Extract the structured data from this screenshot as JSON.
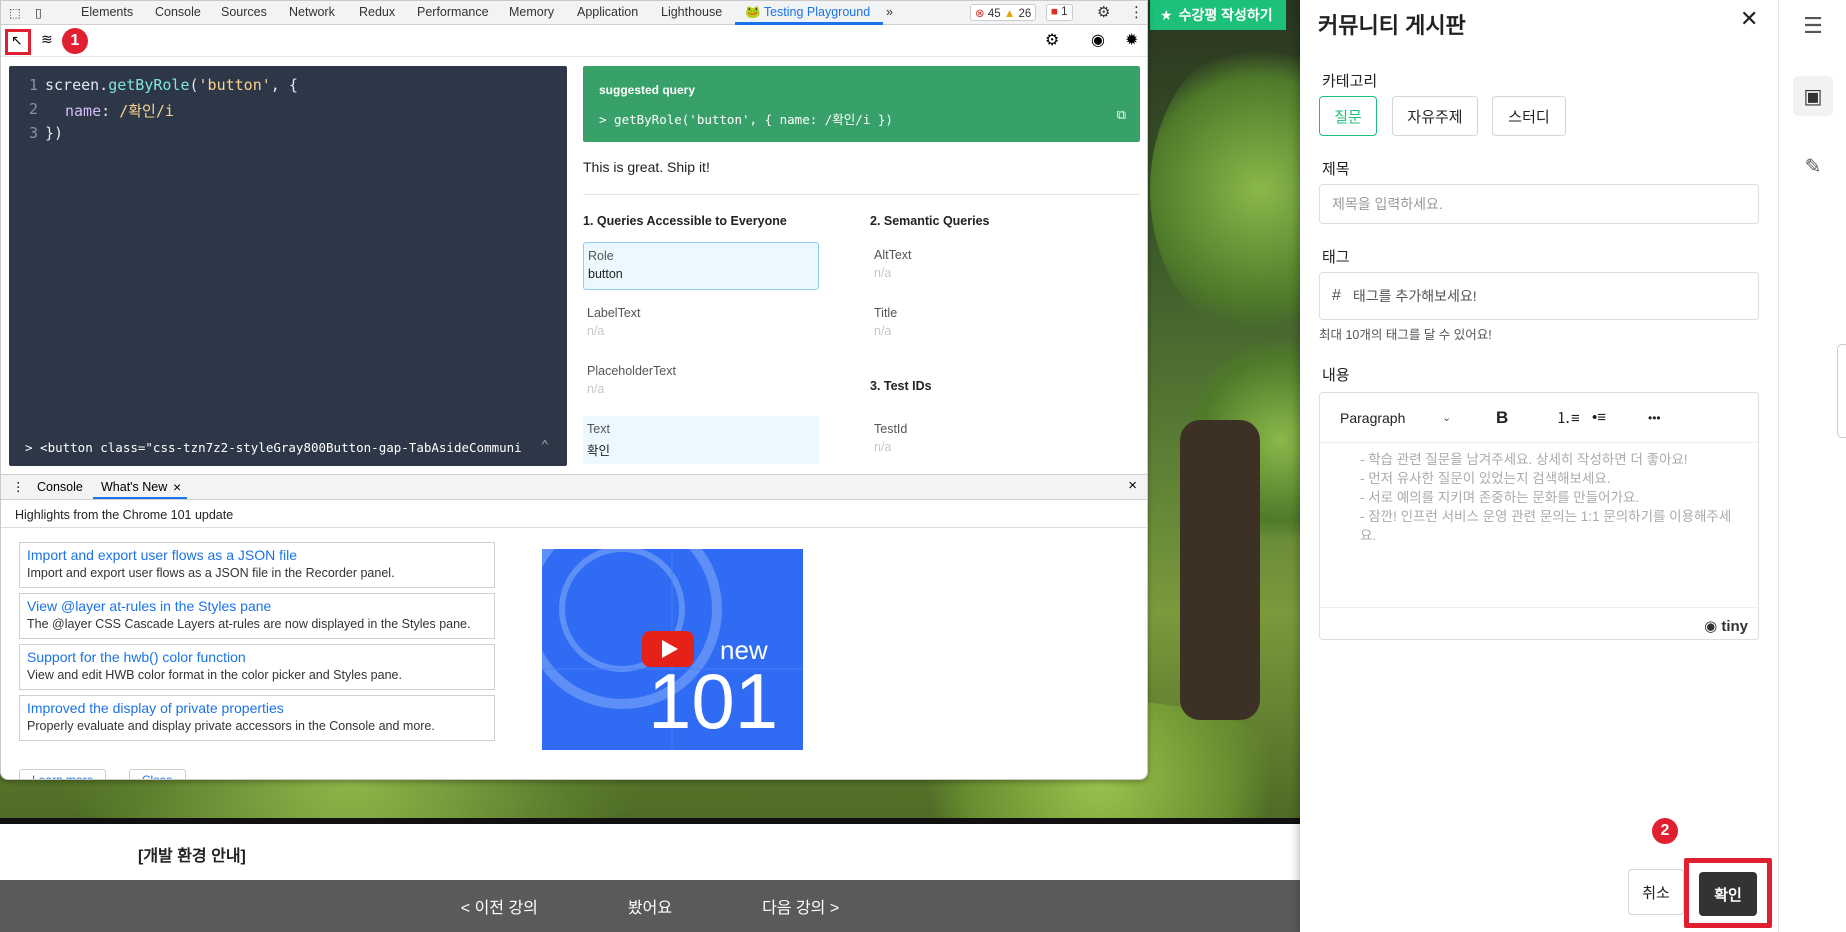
{
  "devtools": {
    "tabs": [
      "Elements",
      "Console",
      "Sources",
      "Network",
      "Redux",
      "Performance",
      "Memory",
      "Application",
      "Lighthouse",
      "Testing Playground"
    ],
    "active_tab": "Testing Playground",
    "more": "»",
    "errors": "45",
    "warnings": "26",
    "issues": "1",
    "marker1": "1",
    "editor": {
      "line_numbers": [
        "1",
        "2",
        "3"
      ],
      "line1_a": "screen.",
      "line1_b": "getByRole",
      "line1_c": "(",
      "line1_d": "'button'",
      "line1_e": ", {",
      "line2_a": "name",
      "line2_b": ": ",
      "line2_c": "/확인/i",
      "line3": "})",
      "footer": "> <button class=\"css-tzn7z2-styleGray800Button-gap-TabAsideCommuni",
      "footer_caret": "⌃"
    },
    "suggested": {
      "title": "suggested query",
      "query": "> getByRole('button', { name: /확인/i })"
    },
    "ship": "This is great. Ship it!",
    "sections": {
      "s1": "1. Queries Accessible to Everyone",
      "s2": "2. Semantic Queries",
      "s3": "3. Test IDs"
    },
    "queries": {
      "role_label": "Role",
      "role_value": "button",
      "labeltext_label": "LabelText",
      "labeltext_value": "n/a",
      "placeholder_label": "PlaceholderText",
      "placeholder_value": "n/a",
      "text_label": "Text",
      "text_value": "확인",
      "alttext_label": "AltText",
      "alttext_value": "n/a",
      "title_label": "Title",
      "title_value": "n/a",
      "testid_label": "TestId",
      "testid_value": "n/a"
    },
    "drawer": {
      "tab_console": "Console",
      "tab_whatsnew": "What's New",
      "close": "×",
      "highlights": "Highlights from the Chrome 101 update",
      "news": [
        {
          "title": "Import and export user flows as a JSON file",
          "desc": "Import and export user flows as a JSON file in the Recorder panel."
        },
        {
          "title": "View @layer at-rules in the Styles pane",
          "desc": "The @layer CSS Cascade Layers at-rules are now displayed in the Styles pane."
        },
        {
          "title": "Support for the hwb() color function",
          "desc": "View and edit HWB color format in the color picker and Styles pane."
        },
        {
          "title": "Improved the display of private properties",
          "desc": "Properly evaluate and display private accessors in the Console and more."
        }
      ],
      "thumb_new": "new",
      "thumb_num": "101",
      "learn_more": "Learn more",
      "close_btn": "Close"
    }
  },
  "page": {
    "review_button": "수강평 작성하기",
    "lecture_info": "[개발 환경 안내]",
    "nav": {
      "prev": "< 이전 강의",
      "seen": "봤어요",
      "next": "다음 강의 >"
    }
  },
  "panel": {
    "title": "커뮤니티 게시판",
    "close": "✕",
    "category_label": "카테고리",
    "categories": [
      "질문",
      "자유주제",
      "스터디"
    ],
    "selected_category": "질문",
    "title_label": "제목",
    "title_placeholder": "제목을 입력하세요.",
    "tag_label": "태그",
    "tag_hash": "#",
    "tag_placeholder": "태그를 추가해보세요!",
    "tag_help": "최대 10개의 태그를 달 수 있어요!",
    "content_label": "내용",
    "editor_format": "Paragraph",
    "editor_bold": "B",
    "editor_more": "•••",
    "editor_placeholder": [
      "- 학습 관련 질문을 남겨주세요. 상세히 작성하면 더 좋아요!",
      "- 먼저 유사한 질문이 있었는지 검색해보세요.",
      "- 서로 예의를 지키며 존중하는 문화를 만들어가요.",
      "- 잠깐! 인프런 서비스 운영 관련 문의는 1:1 문의하기를 이용해주세요."
    ],
    "tiny": "tiny",
    "cancel": "취소",
    "confirm": "확인",
    "marker2": "2"
  },
  "colors": {
    "accent_green": "#1dc078",
    "marker_red": "#e02030",
    "suggest_green": "#38a169",
    "link_blue": "#1a73e8"
  }
}
